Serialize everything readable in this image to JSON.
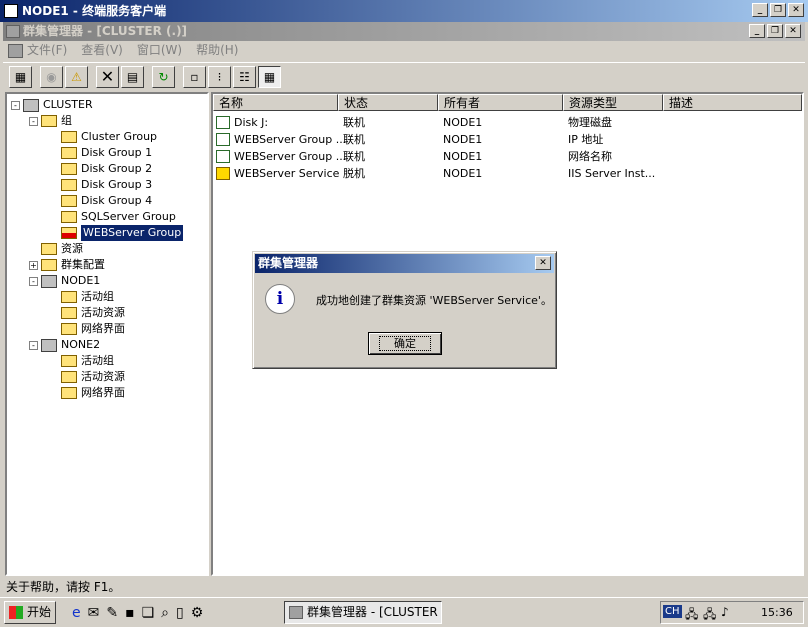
{
  "window": {
    "title": "NODE1 - 终端服务客户端"
  },
  "mdi": {
    "title": "群集管理器 - [CLUSTER (.)]"
  },
  "menu": [
    "文件(F)",
    "查看(V)",
    "窗口(W)",
    "帮助(H)"
  ],
  "tree": [
    {
      "label": "CLUSTER",
      "level": 0,
      "icon": "cluster-icon",
      "expander": "-"
    },
    {
      "label": "组",
      "level": 1,
      "icon": "folder-icon",
      "expander": "-"
    },
    {
      "label": "Cluster Group",
      "level": 2,
      "icon": "group-icon"
    },
    {
      "label": "Disk Group 1",
      "level": 2,
      "icon": "group-icon"
    },
    {
      "label": "Disk Group 2",
      "level": 2,
      "icon": "group-icon"
    },
    {
      "label": "Disk Group 3",
      "level": 2,
      "icon": "group-icon"
    },
    {
      "label": "Disk Group 4",
      "level": 2,
      "icon": "group-icon"
    },
    {
      "label": "SQLServer Group",
      "level": 2,
      "icon": "group-icon"
    },
    {
      "label": "WEBServer Group",
      "level": 2,
      "icon": "group-error-icon",
      "selected": true
    },
    {
      "label": "资源",
      "level": 1,
      "icon": "folder-icon"
    },
    {
      "label": "群集配置",
      "level": 1,
      "icon": "folder-icon",
      "expander": "+"
    },
    {
      "label": "NODE1",
      "level": 1,
      "icon": "server-icon",
      "expander": "-"
    },
    {
      "label": "活动组",
      "level": 2,
      "icon": "folder-icon"
    },
    {
      "label": "活动资源",
      "level": 2,
      "icon": "folder-icon"
    },
    {
      "label": "网络界面",
      "level": 2,
      "icon": "folder-icon"
    },
    {
      "label": "NONE2",
      "level": 1,
      "icon": "server-icon",
      "expander": "-"
    },
    {
      "label": "活动组",
      "level": 2,
      "icon": "folder-icon"
    },
    {
      "label": "活动资源",
      "level": 2,
      "icon": "folder-icon"
    },
    {
      "label": "网络界面",
      "level": 2,
      "icon": "folder-icon"
    }
  ],
  "list": {
    "columns": [
      "名称",
      "状态",
      "所有者",
      "资源类型",
      "描述"
    ],
    "rows": [
      {
        "name": "Disk J:",
        "state": "联机",
        "owner": "NODE1",
        "type": "物理磁盘",
        "icon": "resource-online-icon"
      },
      {
        "name": "WEBServer Group ...",
        "state": "联机",
        "owner": "NODE1",
        "type": "IP 地址",
        "icon": "resource-online-icon"
      },
      {
        "name": "WEBServer Group ...",
        "state": "联机",
        "owner": "NODE1",
        "type": "网络名称",
        "icon": "resource-online-icon"
      },
      {
        "name": "WEBServer Service",
        "state": "脱机",
        "owner": "NODE1",
        "type": "IIS Server Inst...",
        "icon": "resource-warning-icon"
      }
    ]
  },
  "dialog": {
    "title": "群集管理器",
    "message": "成功地创建了群集资源 'WEBServer Service'。",
    "ok": "确定"
  },
  "status": "关于帮助，请按 F1。",
  "taskbar": {
    "start": "开始",
    "task": "群集管理器 - [CLUSTER ...",
    "lang": "CH",
    "clock": "15:36"
  }
}
